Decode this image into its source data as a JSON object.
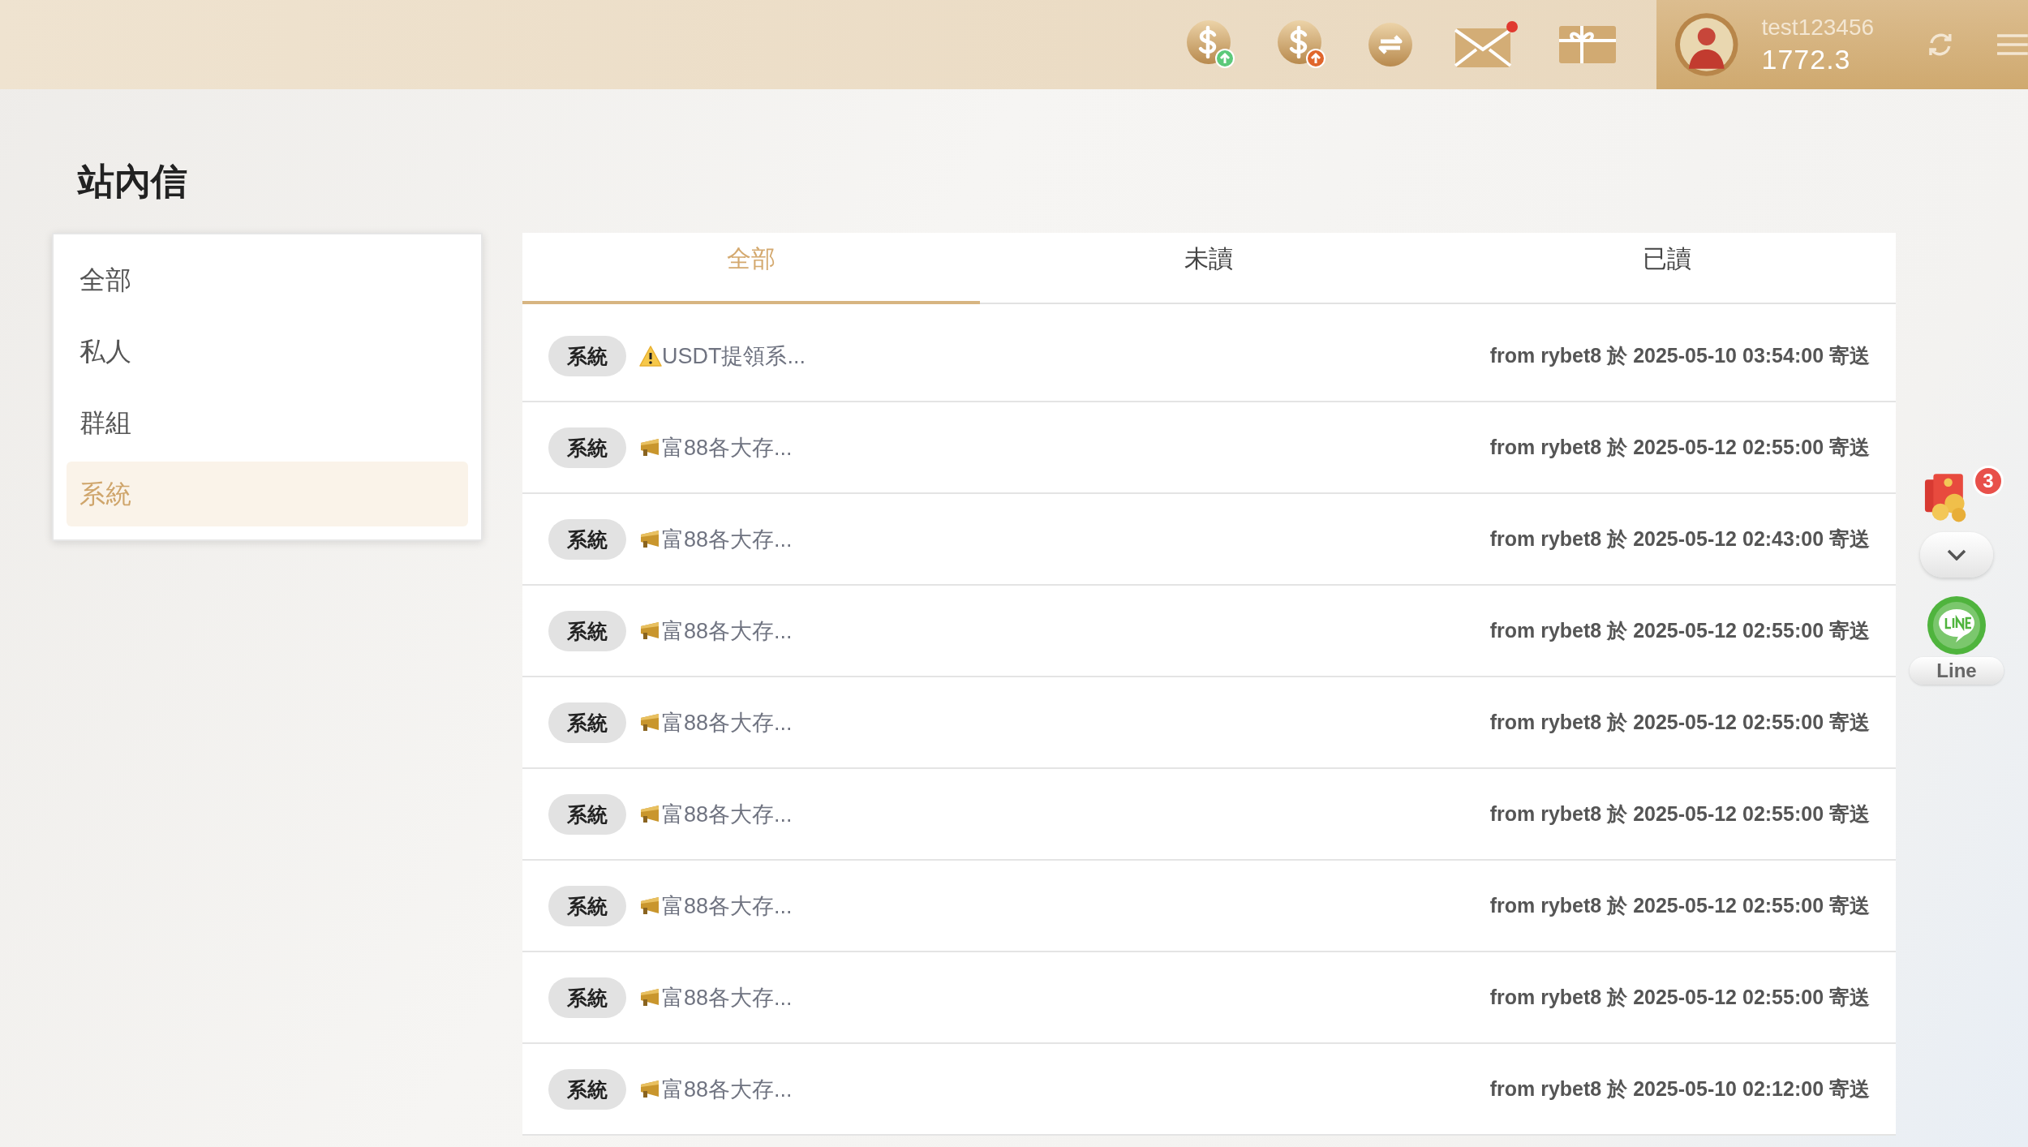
{
  "header": {
    "mail_unread_dot": true,
    "user": {
      "name": "test123456",
      "balance": "1772.3"
    }
  },
  "page_title": "站內信",
  "categories": [
    {
      "label": "全部",
      "selected": false
    },
    {
      "label": "私人",
      "selected": false
    },
    {
      "label": "群組",
      "selected": false
    },
    {
      "label": "系統",
      "selected": true
    }
  ],
  "tabs": [
    {
      "label": "全部",
      "selected": true
    },
    {
      "label": "未讀",
      "selected": false
    },
    {
      "label": "已讀",
      "selected": false
    }
  ],
  "messages": [
    {
      "tag": "系統",
      "kind": "warning",
      "title": "USDT提領系...",
      "meta": "from rybet8 於 2025-05-10 03:54:00 寄送"
    },
    {
      "tag": "系統",
      "kind": "megaphone",
      "title": "富88各大存...",
      "meta": "from rybet8 於 2025-05-12 02:55:00 寄送"
    },
    {
      "tag": "系統",
      "kind": "megaphone",
      "title": "富88各大存...",
      "meta": "from rybet8 於 2025-05-12 02:43:00 寄送"
    },
    {
      "tag": "系統",
      "kind": "megaphone",
      "title": "富88各大存...",
      "meta": "from rybet8 於 2025-05-12 02:55:00 寄送"
    },
    {
      "tag": "系統",
      "kind": "megaphone",
      "title": "富88各大存...",
      "meta": "from rybet8 於 2025-05-12 02:55:00 寄送"
    },
    {
      "tag": "系統",
      "kind": "megaphone",
      "title": "富88各大存...",
      "meta": "from rybet8 於 2025-05-12 02:55:00 寄送"
    },
    {
      "tag": "系統",
      "kind": "megaphone",
      "title": "富88各大存...",
      "meta": "from rybet8 於 2025-05-12 02:55:00 寄送"
    },
    {
      "tag": "系統",
      "kind": "megaphone",
      "title": "富88各大存...",
      "meta": "from rybet8 於 2025-05-12 02:55:00 寄送"
    },
    {
      "tag": "系統",
      "kind": "megaphone",
      "title": "富88各大存...",
      "meta": "from rybet8 於 2025-05-10 02:12:00 寄送"
    }
  ],
  "floating": {
    "gift_badge": "3",
    "line_label": "Line"
  }
}
